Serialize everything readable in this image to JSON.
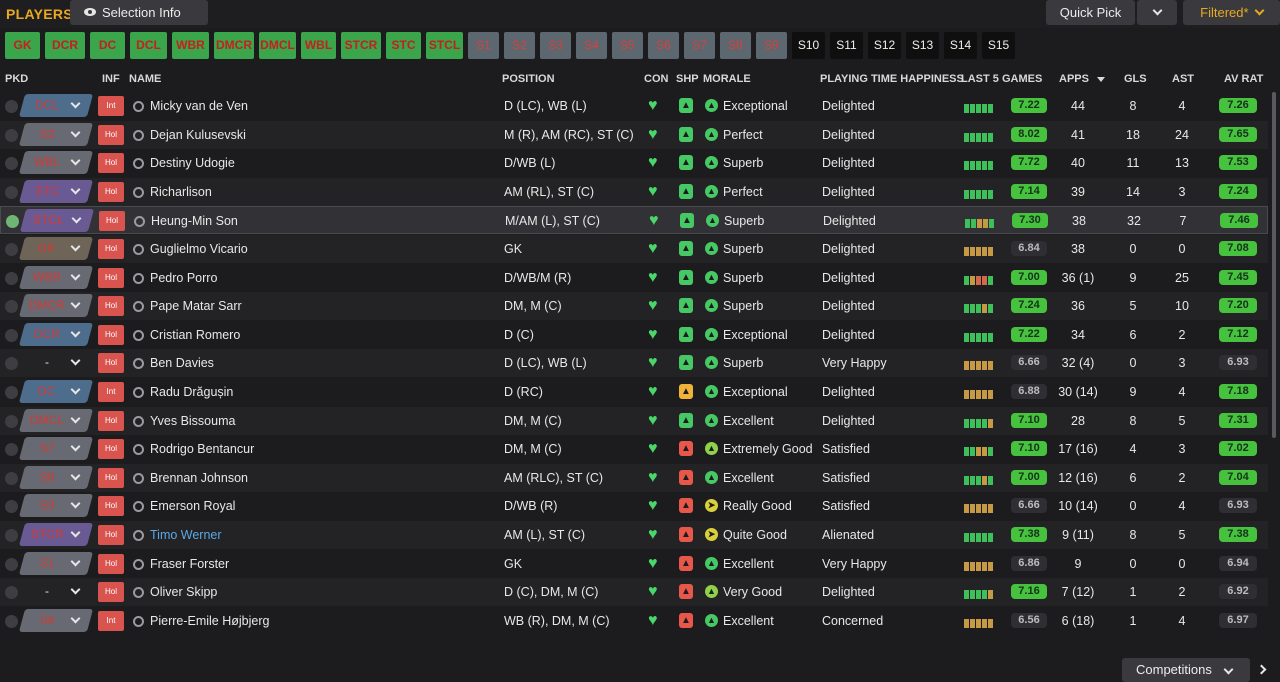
{
  "title": "PLAYERS",
  "selection_info": "Selection Info",
  "quick_pick": "Quick Pick",
  "filter": "Filtered*",
  "competitions": "Competitions",
  "tiles": [
    {
      "label": "GK",
      "style": "g"
    },
    {
      "label": "DCR",
      "style": "g"
    },
    {
      "label": "DC",
      "style": "g"
    },
    {
      "label": "DCL",
      "style": "g"
    },
    {
      "label": "WBR",
      "style": "g"
    },
    {
      "label": "DMCR",
      "style": "g"
    },
    {
      "label": "DMCL",
      "style": "g"
    },
    {
      "label": "WBL",
      "style": "g"
    },
    {
      "label": "STCR",
      "style": "g"
    },
    {
      "label": "STC",
      "style": "g"
    },
    {
      "label": "STCL",
      "style": "g"
    },
    {
      "label": "S1",
      "style": "s"
    },
    {
      "label": "S2",
      "style": "s"
    },
    {
      "label": "S3",
      "style": "s"
    },
    {
      "label": "S4",
      "style": "s"
    },
    {
      "label": "S5",
      "style": "s"
    },
    {
      "label": "S6",
      "style": "s"
    },
    {
      "label": "S7",
      "style": "s"
    },
    {
      "label": "S8",
      "style": "s"
    },
    {
      "label": "S9",
      "style": "s"
    },
    {
      "label": "S10",
      "style": "d"
    },
    {
      "label": "S11",
      "style": "d"
    },
    {
      "label": "S12",
      "style": "d"
    },
    {
      "label": "S13",
      "style": "d"
    },
    {
      "label": "S14",
      "style": "d"
    },
    {
      "label": "S15",
      "style": "d"
    }
  ],
  "columns": {
    "pkd": "PKD",
    "inf": "INF",
    "name": "NAME",
    "position": "POSITION",
    "con": "CON",
    "shp": "SHP",
    "morale": "MORALE",
    "pth": "PLAYING TIME HAPPINESS",
    "last5": "LAST 5 GAMES",
    "apps": "APPS",
    "gls": "GLS",
    "ast": "AST",
    "avrat": "AV RAT"
  },
  "players": [
    {
      "pick": false,
      "pos": "DCL",
      "pos_style": "def",
      "inf": "Int",
      "name": "Micky van de Ven",
      "position": "D (LC), WB (L)",
      "shp": "g",
      "mor": "g",
      "morale": "Exceptional",
      "pth": "Delighted",
      "bars": "ggggg",
      "last5": "7.22",
      "l5c": "g",
      "apps": "44",
      "gls": "8",
      "ast": "4",
      "av": "7.26",
      "avc": "g"
    },
    {
      "pick": false,
      "pos": "S2",
      "pos_style": "mid",
      "inf": "Hol",
      "name": "Dejan Kulusevski",
      "position": "M (R), AM (RC), ST (C)",
      "shp": "g",
      "mor": "g",
      "morale": "Perfect",
      "pth": "Delighted",
      "bars": "ggggg",
      "last5": "8.02",
      "l5c": "g",
      "apps": "41",
      "gls": "18",
      "ast": "24",
      "av": "7.65",
      "avc": "g"
    },
    {
      "pick": false,
      "pos": "WBL",
      "pos_style": "mid",
      "inf": "Hol",
      "name": "Destiny Udogie",
      "position": "D/WB (L)",
      "shp": "g",
      "mor": "g",
      "morale": "Superb",
      "pth": "Delighted",
      "bars": "ggggg",
      "last5": "7.72",
      "l5c": "g",
      "apps": "40",
      "gls": "11",
      "ast": "13",
      "av": "7.53",
      "avc": "g"
    },
    {
      "pick": false,
      "pos": "STC",
      "pos_style": "atk",
      "inf": "Hol",
      "name": "Richarlison",
      "position": "AM (RL), ST (C)",
      "shp": "g",
      "mor": "g",
      "morale": "Perfect",
      "pth": "Delighted",
      "bars": "ggggg",
      "last5": "7.14",
      "l5c": "g",
      "apps": "39",
      "gls": "14",
      "ast": "3",
      "av": "7.24",
      "avc": "g"
    },
    {
      "pick": true,
      "pos": "STCL",
      "pos_style": "atk",
      "inf": "Hol",
      "name": "Heung-Min Son",
      "position": "M/AM (L), ST (C)",
      "shp": "g",
      "mor": "g",
      "morale": "Superb",
      "pth": "Delighted",
      "bars": "ggoog",
      "last5": "7.30",
      "l5c": "g",
      "apps": "38",
      "gls": "32",
      "ast": "7",
      "av": "7.46",
      "avc": "g"
    },
    {
      "pick": false,
      "pos": "GK",
      "pos_style": "gk",
      "inf": "Hol",
      "name": "Guglielmo Vicario",
      "position": "GK",
      "shp": "g",
      "mor": "g",
      "morale": "Superb",
      "pth": "Delighted",
      "bars": "ooooo",
      "last5": "6.84",
      "l5c": "gray",
      "apps": "38",
      "gls": "0",
      "ast": "0",
      "av": "7.08",
      "avc": "g"
    },
    {
      "pick": false,
      "pos": "WBR",
      "pos_style": "mid",
      "inf": "Hol",
      "name": "Pedro Porro",
      "position": "D/WB/M (R)",
      "shp": "g",
      "mor": "g",
      "morale": "Superb",
      "pth": "Delighted",
      "bars": "gorrg",
      "last5": "7.00",
      "l5c": "g",
      "apps": "36 (1)",
      "gls": "9",
      "ast": "25",
      "av": "7.45",
      "avc": "g"
    },
    {
      "pick": false,
      "pos": "DMCR",
      "pos_style": "mid",
      "inf": "Hol",
      "name": "Pape Matar Sarr",
      "position": "DM, M (C)",
      "shp": "g",
      "mor": "g",
      "morale": "Superb",
      "pth": "Delighted",
      "bars": "gggog",
      "last5": "7.24",
      "l5c": "g",
      "apps": "36",
      "gls": "5",
      "ast": "10",
      "av": "7.20",
      "avc": "g"
    },
    {
      "pick": false,
      "pos": "DCR",
      "pos_style": "def",
      "inf": "Hol",
      "name": "Cristian Romero",
      "position": "D (C)",
      "shp": "g",
      "mor": "g",
      "morale": "Exceptional",
      "pth": "Delighted",
      "bars": "ggggg",
      "last5": "7.22",
      "l5c": "g",
      "apps": "34",
      "gls": "6",
      "ast": "2",
      "av": "7.12",
      "avc": "g"
    },
    {
      "pick": false,
      "pos": "-",
      "pos_style": "none",
      "inf": "Hol",
      "name": "Ben Davies",
      "position": "D (LC), WB (L)",
      "shp": "g",
      "mor": "g",
      "morale": "Superb",
      "pth": "Very Happy",
      "bars": "ooooo",
      "last5": "6.66",
      "l5c": "gray",
      "apps": "32 (4)",
      "gls": "0",
      "ast": "3",
      "av": "6.93",
      "avc": "gray"
    },
    {
      "pick": false,
      "pos": "DC",
      "pos_style": "def",
      "inf": "Int",
      "name": "Radu Drăgușin",
      "position": "D (RC)",
      "shp": "y",
      "mor": "g",
      "morale": "Exceptional",
      "pth": "Delighted",
      "bars": "ooooo",
      "last5": "6.88",
      "l5c": "gray",
      "apps": "30 (14)",
      "gls": "9",
      "ast": "4",
      "av": "7.18",
      "avc": "g"
    },
    {
      "pick": false,
      "pos": "DMCL",
      "pos_style": "mid",
      "inf": "Hol",
      "name": "Yves Bissouma",
      "position": "DM, M (C)",
      "shp": "g",
      "mor": "g",
      "morale": "Excellent",
      "pth": "Delighted",
      "bars": "ggggo",
      "last5": "7.10",
      "l5c": "g",
      "apps": "28",
      "gls": "8",
      "ast": "5",
      "av": "7.31",
      "avc": "g"
    },
    {
      "pick": false,
      "pos": "S7",
      "pos_style": "mid",
      "inf": "Hol",
      "name": "Rodrigo Bentancur",
      "position": "DM, M (C)",
      "shp": "r",
      "mor": "lg",
      "morale": "Extremely Good",
      "pth": "Satisfied",
      "bars": "ggoog",
      "last5": "7.10",
      "l5c": "g",
      "apps": "17 (16)",
      "gls": "4",
      "ast": "3",
      "av": "7.02",
      "avc": "g"
    },
    {
      "pick": false,
      "pos": "S8",
      "pos_style": "mid",
      "inf": "Hol",
      "name": "Brennan Johnson",
      "position": "AM (RLC), ST (C)",
      "shp": "r",
      "mor": "g",
      "morale": "Excellent",
      "pth": "Satisfied",
      "bars": "gggog",
      "last5": "7.00",
      "l5c": "g",
      "apps": "12 (16)",
      "gls": "6",
      "ast": "2",
      "av": "7.04",
      "avc": "g"
    },
    {
      "pick": false,
      "pos": "S3",
      "pos_style": "mid",
      "inf": "Hol",
      "name": "Emerson Royal",
      "position": "D/WB (R)",
      "shp": "r",
      "mor": "y",
      "morale": "Really Good",
      "pth": "Satisfied",
      "bars": "ooooo",
      "last5": "6.66",
      "l5c": "gray",
      "apps": "10 (14)",
      "gls": "0",
      "ast": "4",
      "av": "6.93",
      "avc": "gray"
    },
    {
      "pick": false,
      "pos": "STCR",
      "pos_style": "atk",
      "inf": "Hol",
      "name": "Timo Werner",
      "position": "AM (L), ST (C)",
      "shp": "r",
      "mor": "y",
      "morale": "Quite Good",
      "pth": "Alienated",
      "bars": "ggggg",
      "last5": "7.38",
      "l5c": "g",
      "apps": "9 (11)",
      "gls": "8",
      "ast": "5",
      "av": "7.38",
      "avc": "g",
      "blue": true
    },
    {
      "pick": false,
      "pos": "S1",
      "pos_style": "mid",
      "inf": "Hol",
      "name": "Fraser Forster",
      "position": "GK",
      "shp": "r",
      "mor": "g",
      "morale": "Excellent",
      "pth": "Very Happy",
      "bars": "ooooo",
      "last5": "6.86",
      "l5c": "gray",
      "apps": "9",
      "gls": "0",
      "ast": "0",
      "av": "6.94",
      "avc": "gray"
    },
    {
      "pick": false,
      "pos": "-",
      "pos_style": "none",
      "inf": "Hol",
      "name": "Oliver Skipp",
      "position": "D (C), DM, M (C)",
      "shp": "r",
      "mor": "lg",
      "morale": "Very Good",
      "pth": "Delighted",
      "bars": "ggggo",
      "last5": "7.16",
      "l5c": "g",
      "apps": "7 (12)",
      "gls": "1",
      "ast": "2",
      "av": "6.92",
      "avc": "gray"
    },
    {
      "pick": false,
      "pos": "S6",
      "pos_style": "mid",
      "inf": "Int",
      "name": "Pierre-Emile Højbjerg",
      "position": "WB (R), DM, M (C)",
      "shp": "r",
      "mor": "g",
      "morale": "Excellent",
      "pth": "Concerned",
      "bars": "ooooo",
      "last5": "6.56",
      "l5c": "gray",
      "apps": "6 (18)",
      "gls": "1",
      "ast": "4",
      "av": "6.97",
      "avc": "gray"
    }
  ],
  "colors": {
    "accent": "#e8a920",
    "green": "#47c23e",
    "red": "#d9534f",
    "bg": "#1c1c1f"
  }
}
